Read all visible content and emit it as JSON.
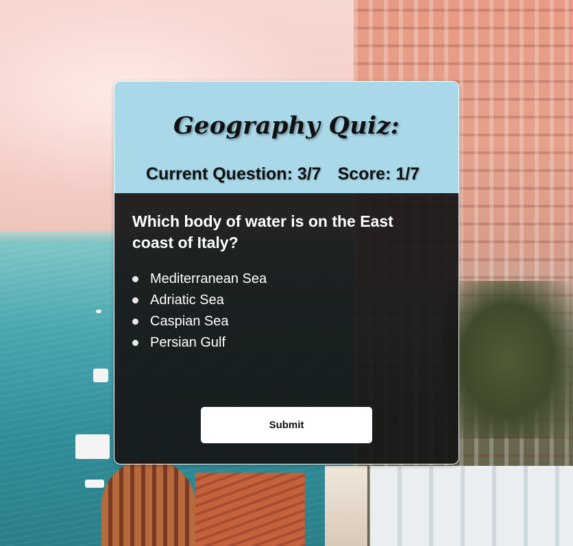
{
  "quiz": {
    "title": "Geography Quiz:",
    "current_question_text": "Current Question: 3/7",
    "score_text": "Score: 1/7"
  },
  "question": {
    "text": "Which body of water is on the East coast of Italy?",
    "options": [
      {
        "label": "Mediterranean Sea"
      },
      {
        "label": "Adriatic Sea"
      },
      {
        "label": "Caspian Sea"
      },
      {
        "label": "Persian Gulf"
      }
    ]
  },
  "actions": {
    "submit_label": "Submit"
  },
  "colors": {
    "header_background": "#a9d8e9",
    "body_background": "#161616",
    "button_background": "#ffffff",
    "text_light": "#ffffff",
    "text_dark": "#101010"
  },
  "icons": {
    "option_marker": "radio-dot-icon"
  }
}
